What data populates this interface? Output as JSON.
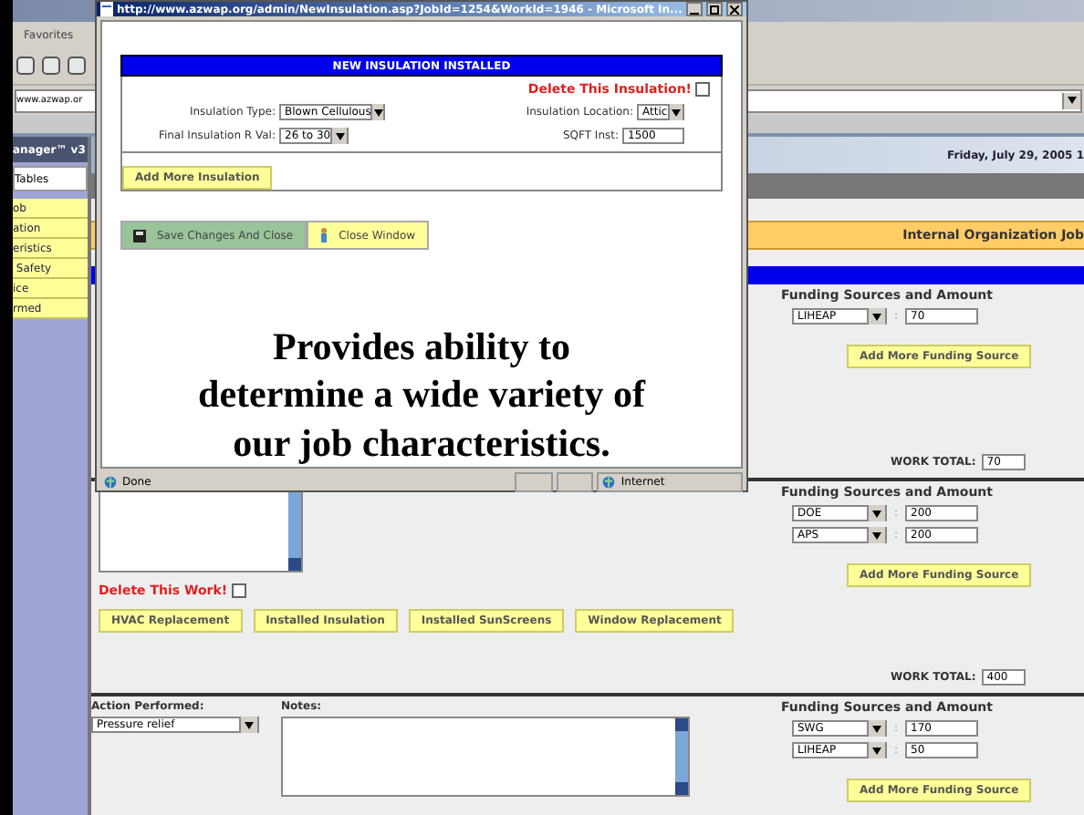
{
  "browser": {
    "menu": "Favorites",
    "address": "www.azwap.or"
  },
  "sidebar": {
    "app_title": "anager™ v3",
    "tab": "Tables",
    "items": [
      "ob",
      "ation",
      "eristics",
      " Safety",
      "ice",
      "rmed"
    ]
  },
  "page": {
    "date": "Friday, July 29, 2005 1",
    "section_title": "Internal Organization Job"
  },
  "works": [
    {
      "funding_heading": "Funding Sources and Amount",
      "funding": [
        {
          "source": "LIHEAP",
          "separator": ":",
          "amount": "70"
        }
      ],
      "add_funding": "Add More Funding Source",
      "total_label": "WORK TOTAL:",
      "total": "70"
    },
    {
      "delete_label": "Delete This Work!",
      "delete_checked": false,
      "work_buttons": [
        "HVAC Replacement",
        "Installed Insulation",
        "Installed SunScreens",
        "Window Replacement"
      ],
      "funding_heading": "Funding Sources and Amount",
      "funding": [
        {
          "source": "DOE",
          "separator": ":",
          "amount": "200"
        },
        {
          "source": "APS",
          "separator": ":",
          "amount": "200"
        }
      ],
      "add_funding": "Add More Funding Source",
      "total_label": "WORK TOTAL:",
      "total": "400"
    },
    {
      "action_label": "Action Performed:",
      "action": "Pressure relief",
      "notes_label": "Notes:",
      "funding_heading": "Funding Sources and Amount",
      "funding": [
        {
          "source": "SWG",
          "separator": ":",
          "amount": "170"
        },
        {
          "source": "LIHEAP",
          "separator": ":",
          "amount": "50"
        }
      ],
      "add_funding": "Add More Funding Source"
    }
  ],
  "popup": {
    "title": "http://www.azwap.org/admin/NewInsulation.asp?JobId=1254&WorkId=1946 - Microsoft In...",
    "heading": "NEW INSULATION INSTALLED",
    "delete_label": "Delete This Insulation!",
    "delete_checked": false,
    "fields": [
      {
        "label": "Insulation Type:",
        "value": "Blown Cellulous",
        "kind": "select"
      },
      {
        "label": "Insulation Location:",
        "value": "Attic",
        "kind": "select"
      },
      {
        "label": "Final Insulation R Val:",
        "value": "26 to 30",
        "kind": "select"
      },
      {
        "label": "SQFT Inst:",
        "value": "1500",
        "kind": "input"
      }
    ],
    "add_button": "Add More Insulation",
    "save_button": "Save Changes And Close",
    "close_button": "Close Window",
    "status": "Done",
    "zone": "Internet"
  },
  "caption": "Provides ability to determine a wide variety of our job characteristics."
}
